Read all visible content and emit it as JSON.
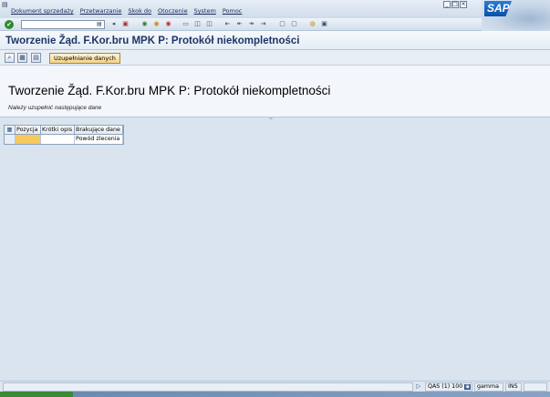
{
  "menu": {
    "items": [
      "Dokument sprzedaży",
      "Przetwarzanie",
      "Skok do",
      "Otoczenie",
      "System",
      "Pomoc"
    ]
  },
  "window_controls": [
    "_",
    "□",
    "×"
  ],
  "logo": "SAP",
  "std_toolbar": {
    "command_value": "",
    "icons": [
      "enter-icon",
      "save-icon",
      "back-icon",
      "exit-icon",
      "cancel-icon",
      "print-icon",
      "find-icon",
      "find-next-icon",
      "first-page-icon",
      "prev-page-icon",
      "next-page-icon",
      "last-page-icon",
      "new-session-icon",
      "shortcut-icon",
      "help-icon",
      "customize-icon"
    ]
  },
  "title": "Tworzenie Žąd. F.Kor.bru MPK P: Protokół niekompletności",
  "app_toolbar": {
    "button_label": "Uzupełnianie danych"
  },
  "header": {
    "heading": "Tworzenie Žąd. F.Kor.bru MPK P: Protokół niekompletności",
    "subtitle": "Należy uzupełnić następujące dane"
  },
  "table": {
    "columns": [
      "Pozycja",
      "Krótki opis",
      "Brakujące dane"
    ],
    "rows": [
      {
        "pozycja": "",
        "opis": "",
        "brakujace": "Powód zlecenia"
      }
    ]
  },
  "status": {
    "message": "",
    "system": "QAS (1) 100",
    "server": "gamma",
    "mode": "INS"
  },
  "colors": {
    "title": "#1d3566",
    "highlight_cell": "#f6c95e",
    "workspace": "#d9e4ef"
  }
}
